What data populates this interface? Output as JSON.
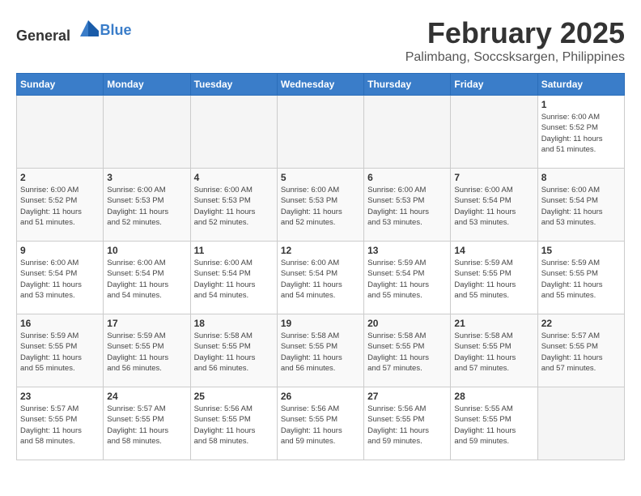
{
  "header": {
    "logo_general": "General",
    "logo_blue": "Blue",
    "title": "February 2025",
    "subtitle": "Palimbang, Soccsksargen, Philippines"
  },
  "days_of_week": [
    "Sunday",
    "Monday",
    "Tuesday",
    "Wednesday",
    "Thursday",
    "Friday",
    "Saturday"
  ],
  "weeks": [
    [
      {
        "day": "",
        "info": ""
      },
      {
        "day": "",
        "info": ""
      },
      {
        "day": "",
        "info": ""
      },
      {
        "day": "",
        "info": ""
      },
      {
        "day": "",
        "info": ""
      },
      {
        "day": "",
        "info": ""
      },
      {
        "day": "1",
        "info": "Sunrise: 6:00 AM\nSunset: 5:52 PM\nDaylight: 11 hours\nand 51 minutes."
      }
    ],
    [
      {
        "day": "2",
        "info": "Sunrise: 6:00 AM\nSunset: 5:52 PM\nDaylight: 11 hours\nand 51 minutes."
      },
      {
        "day": "3",
        "info": "Sunrise: 6:00 AM\nSunset: 5:53 PM\nDaylight: 11 hours\nand 52 minutes."
      },
      {
        "day": "4",
        "info": "Sunrise: 6:00 AM\nSunset: 5:53 PM\nDaylight: 11 hours\nand 52 minutes."
      },
      {
        "day": "5",
        "info": "Sunrise: 6:00 AM\nSunset: 5:53 PM\nDaylight: 11 hours\nand 52 minutes."
      },
      {
        "day": "6",
        "info": "Sunrise: 6:00 AM\nSunset: 5:53 PM\nDaylight: 11 hours\nand 53 minutes."
      },
      {
        "day": "7",
        "info": "Sunrise: 6:00 AM\nSunset: 5:54 PM\nDaylight: 11 hours\nand 53 minutes."
      },
      {
        "day": "8",
        "info": "Sunrise: 6:00 AM\nSunset: 5:54 PM\nDaylight: 11 hours\nand 53 minutes."
      }
    ],
    [
      {
        "day": "9",
        "info": "Sunrise: 6:00 AM\nSunset: 5:54 PM\nDaylight: 11 hours\nand 53 minutes."
      },
      {
        "day": "10",
        "info": "Sunrise: 6:00 AM\nSunset: 5:54 PM\nDaylight: 11 hours\nand 54 minutes."
      },
      {
        "day": "11",
        "info": "Sunrise: 6:00 AM\nSunset: 5:54 PM\nDaylight: 11 hours\nand 54 minutes."
      },
      {
        "day": "12",
        "info": "Sunrise: 6:00 AM\nSunset: 5:54 PM\nDaylight: 11 hours\nand 54 minutes."
      },
      {
        "day": "13",
        "info": "Sunrise: 5:59 AM\nSunset: 5:54 PM\nDaylight: 11 hours\nand 55 minutes."
      },
      {
        "day": "14",
        "info": "Sunrise: 5:59 AM\nSunset: 5:55 PM\nDaylight: 11 hours\nand 55 minutes."
      },
      {
        "day": "15",
        "info": "Sunrise: 5:59 AM\nSunset: 5:55 PM\nDaylight: 11 hours\nand 55 minutes."
      }
    ],
    [
      {
        "day": "16",
        "info": "Sunrise: 5:59 AM\nSunset: 5:55 PM\nDaylight: 11 hours\nand 55 minutes."
      },
      {
        "day": "17",
        "info": "Sunrise: 5:59 AM\nSunset: 5:55 PM\nDaylight: 11 hours\nand 56 minutes."
      },
      {
        "day": "18",
        "info": "Sunrise: 5:58 AM\nSunset: 5:55 PM\nDaylight: 11 hours\nand 56 minutes."
      },
      {
        "day": "19",
        "info": "Sunrise: 5:58 AM\nSunset: 5:55 PM\nDaylight: 11 hours\nand 56 minutes."
      },
      {
        "day": "20",
        "info": "Sunrise: 5:58 AM\nSunset: 5:55 PM\nDaylight: 11 hours\nand 57 minutes."
      },
      {
        "day": "21",
        "info": "Sunrise: 5:58 AM\nSunset: 5:55 PM\nDaylight: 11 hours\nand 57 minutes."
      },
      {
        "day": "22",
        "info": "Sunrise: 5:57 AM\nSunset: 5:55 PM\nDaylight: 11 hours\nand 57 minutes."
      }
    ],
    [
      {
        "day": "23",
        "info": "Sunrise: 5:57 AM\nSunset: 5:55 PM\nDaylight: 11 hours\nand 58 minutes."
      },
      {
        "day": "24",
        "info": "Sunrise: 5:57 AM\nSunset: 5:55 PM\nDaylight: 11 hours\nand 58 minutes."
      },
      {
        "day": "25",
        "info": "Sunrise: 5:56 AM\nSunset: 5:55 PM\nDaylight: 11 hours\nand 58 minutes."
      },
      {
        "day": "26",
        "info": "Sunrise: 5:56 AM\nSunset: 5:55 PM\nDaylight: 11 hours\nand 59 minutes."
      },
      {
        "day": "27",
        "info": "Sunrise: 5:56 AM\nSunset: 5:55 PM\nDaylight: 11 hours\nand 59 minutes."
      },
      {
        "day": "28",
        "info": "Sunrise: 5:55 AM\nSunset: 5:55 PM\nDaylight: 11 hours\nand 59 minutes."
      },
      {
        "day": "",
        "info": ""
      }
    ]
  ]
}
